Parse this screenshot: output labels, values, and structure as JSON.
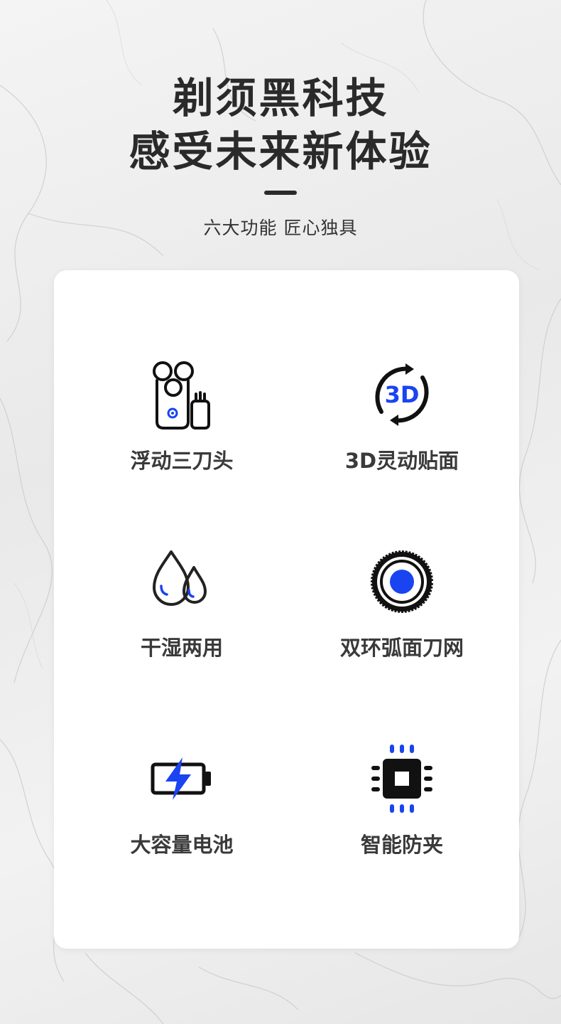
{
  "header": {
    "title_line1": "剃须黑科技",
    "title_line2": "感受未来新体验",
    "subtitle": "六大功能 匠心独具"
  },
  "colors": {
    "accent": "#1a44f0",
    "text": "#2a2a2a",
    "card": "#ffffff"
  },
  "features": [
    {
      "label": "浮动三刀头",
      "icon": "triple-head-shaver-icon"
    },
    {
      "label": "3D灵动贴面",
      "icon": "3d-rotate-icon",
      "icon_text": "3D"
    },
    {
      "label": "干湿两用",
      "icon": "water-drops-icon"
    },
    {
      "label": "双环弧面刀网",
      "icon": "dual-ring-blade-net-icon"
    },
    {
      "label": "大容量电池",
      "icon": "battery-charge-icon"
    },
    {
      "label": "智能防夹",
      "icon": "smart-chip-icon"
    }
  ]
}
